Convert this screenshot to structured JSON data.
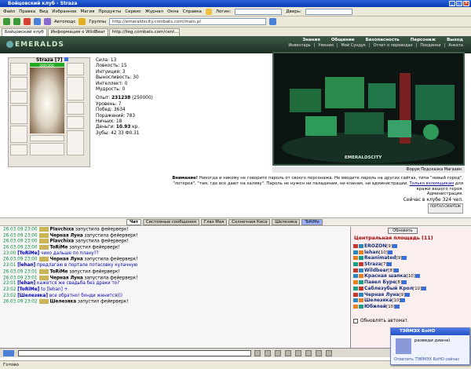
{
  "window": {
    "title": "Бойцовский клуб - Straza"
  },
  "menu": {
    "items": [
      "Файл",
      "Правка",
      "Вид",
      "Избранное",
      "Магия",
      "Продукты",
      "Сервис",
      "Журнал",
      "Окна",
      "Справка"
    ],
    "login_label": "Логин:",
    "door_label": "Дверь:"
  },
  "toolbar": {
    "autofill_label": "Автоподс",
    "groups_label": "Группы",
    "address": "http://emeraldscity.combats.com/main.pl"
  },
  "tabs": [
    {
      "label": "Бойцовский клуб"
    },
    {
      "label": "Информация о WildBear"
    },
    {
      "label": "http://lleg.combats.com/cent..."
    }
  ],
  "nav": {
    "logo": "EMERALDS",
    "top_links": [
      "Знания",
      "Общение",
      "Безопасность",
      "Персонаж",
      "Выход"
    ],
    "sub_links": [
      "Инвентарь",
      "Умения",
      "Мой Сундук",
      "Отчет о переводах",
      "Поединки",
      "Анкета"
    ]
  },
  "character": {
    "name": "Straza",
    "level": "[7]",
    "hp": "300/300",
    "stats": [
      "Сила: 13",
      "Ловкость: 15",
      "Интуиция: 3",
      "Выносливость: 30",
      "Интеллект: 0",
      "Мудрость: 0"
    ],
    "experience_label": "Опыт:",
    "experience_value": "231238",
    "experience_next": "(250000)",
    "rank": "Уровень: 7",
    "wins": "Побед: 3634",
    "losses": "Поражений: 783",
    "draws": "Ничьих: 18",
    "money_label": "Деньги:",
    "money_value": "10.93",
    "money_unit": "кр.",
    "teeth": "Зубы: 42 ЗЗ Ф0.31"
  },
  "city": {
    "caption": "EMERALDSCITY",
    "bar_links": [
      "Форум",
      "Подсказка",
      "Магазин"
    ]
  },
  "warning": {
    "bold": "Внимание!",
    "text": "Никогда и никому не говорите пароль от своего персонажа. Не вводите пароль на других сайтах, типа \"новый город\", \"лотерея\", \"там, где все дают на халяву\". Пароль не нужен ни паладинам, ни кланам, ни администрации.",
    "link_text": "Только взломщикам",
    "tail": "для кражи вашего героя.",
    "signature": "Администрация."
  },
  "online": "Сейчас в клубе 324 чел.",
  "minilogo": "ПОРТАЛ-СМАРТЕЖ",
  "chat": {
    "tabs": [
      {
        "label": "Чат",
        "state": "active"
      },
      {
        "label": "Системные сообщения",
        "state": ""
      },
      {
        "label": "Глаз Мая",
        "state": ""
      },
      {
        "label": "Солнечная Киса",
        "state": ""
      },
      {
        "label": "Шелезяка",
        "state": ""
      },
      {
        "label": "ToRiMe",
        "state": "hl"
      }
    ],
    "messages": [
      {
        "time": "26.03.09 23:00",
        "name": "Plavchixa",
        "text": "запустила фейерверк!",
        "icon": true,
        "private": false
      },
      {
        "time": "26.03.09 23:00",
        "name": "Черная Луна",
        "text": "запустила фейерверк!",
        "icon": true,
        "private": false
      },
      {
        "time": "26.03.09 23:00",
        "name": "Plavchixa",
        "text": "запустила фейерверк!",
        "icon": true,
        "private": false
      },
      {
        "time": "26.03.09 23:00",
        "name": "ToRiMe",
        "text": "запустил фейерверк!",
        "icon": true,
        "private": false
      },
      {
        "time": "23:00",
        "name": "[ToRiMe]",
        "text": "чихо дальше по плану??",
        "icon": false,
        "private": true
      },
      {
        "time": "26.03.09 23:00",
        "name": "Черная Луна",
        "text": "запустила фейерверк!",
        "icon": true,
        "private": false
      },
      {
        "time": "23:01",
        "name": "[lehan]",
        "text": "предлагаю в портале потасовку кулачную",
        "icon": false,
        "private": true
      },
      {
        "time": "26.03.09 23:01",
        "name": "ToRiMe",
        "text": "запустил фейерверк!",
        "icon": true,
        "private": false
      },
      {
        "time": "26.03.09 23:01",
        "name": "Черная Луна",
        "text": "запустила фейерверк!",
        "icon": true,
        "private": false
      },
      {
        "time": "23:01",
        "name": "[lehan]",
        "text": "кажется же свадьба без драки то?",
        "icon": false,
        "private": true
      },
      {
        "time": "23:02",
        "name": "[ToRiMe]",
        "text": "to [lehan] +",
        "icon": false,
        "private": true
      },
      {
        "time": "23:02",
        "name": "[Шелезяка]",
        "text": "все обратно! бонди женится)))",
        "icon": false,
        "private": true
      },
      {
        "time": "26.03.09 23:02",
        "name": "Шелезяка",
        "text": "запустил фейерверк!",
        "icon": true,
        "private": false
      }
    ]
  },
  "room": {
    "refresh_label": "Обновить",
    "title": "Центральная площадь (11)",
    "users": [
      {
        "name": "EROZON",
        "level": "[9]"
      },
      {
        "name": "lehan",
        "level": "[10]"
      },
      {
        "name": "Reanimated",
        "level": "[9]"
      },
      {
        "name": "Straza",
        "level": "[7]"
      },
      {
        "name": "Wildbear",
        "level": "[8]"
      },
      {
        "name": "Красная шапка",
        "level": "[10]"
      },
      {
        "name": "Павел Буре",
        "level": "[8]"
      },
      {
        "name": "Саблезубый Крол",
        "level": "[10]"
      },
      {
        "name": "Черная Луна",
        "level": "[9]"
      },
      {
        "name": "Шелезяка",
        "level": "[10]"
      },
      {
        "name": "Юбилей",
        "level": "[10]"
      }
    ],
    "auto_refresh_label": "Обновлять автомат."
  },
  "statusbar": {
    "text": "Готово"
  },
  "popup": {
    "title": "ТЭЙМЭХ БоНО",
    "body": "разведи диана)",
    "footer": "Ответить ТЭЙМЭХ БоНО сейчас"
  },
  "colors": {
    "accent": "#2a62d8",
    "nav_bg": "#1e2f24",
    "time": "#0a8a3c",
    "room_title": "#aa0000"
  }
}
